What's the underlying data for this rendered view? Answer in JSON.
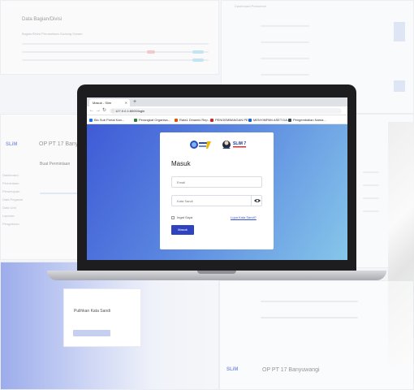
{
  "background": {
    "top_left": {
      "title": "Data Bagian/Divisi",
      "subtitle": "Bagian/Divisi Perusahaan Gudang Garam"
    },
    "top_right": {
      "title": "Dashboard Personnel"
    },
    "middle_left": {
      "brand": "SLiM",
      "section_title": "Buat Permintaan",
      "menu": [
        "Dashboard",
        "Permintaan",
        "Persetujuan",
        "Data Pegawai",
        "Data Unit",
        "Laporan",
        "Pengaturan"
      ]
    },
    "bottom_left": {
      "card_title": "Pulihkan Kata Sandi"
    },
    "bottom_right": {
      "brand": "SLiM",
      "heading": "OP PT 17 Banyuwangi"
    },
    "middle_heading": "OP PT 17 Banyuwangi"
  },
  "browser": {
    "tab_title": "Masuk - Slim",
    "url": "127.0.0.1:8000/login",
    "bookmarks": [
      {
        "label": "Bio Sub Portal Kan...",
        "color": "#1a73e8"
      },
      {
        "label": "Perangkat Organisa...",
        "color": "#2e7d32"
      },
      {
        "label": "Rata1 Dinamis Rep...",
        "color": "#e65100"
      },
      {
        "label": "PENGEMBANGAN PE...",
        "color": "#c62828"
      },
      {
        "label": "MENYIMPAN ASET DA...",
        "color": "#1565c0"
      },
      {
        "label": "Pengembalian Nama...",
        "color": "#37474f"
      }
    ]
  },
  "login": {
    "logo_text_1": "GUDANG",
    "logo_text_2": "SLiM 7",
    "title": "Masuk",
    "email_placeholder": "Email",
    "password_placeholder": "Kata Sandi",
    "remember_label": "Ingat Saya",
    "forgot_label": "Lupa Kata Sandi?",
    "submit_label": "Masuk"
  },
  "colors": {
    "page_gradient_start": "#3f5bd6",
    "page_gradient_end": "#86c6ea",
    "primary_button": "#2f43c0"
  }
}
